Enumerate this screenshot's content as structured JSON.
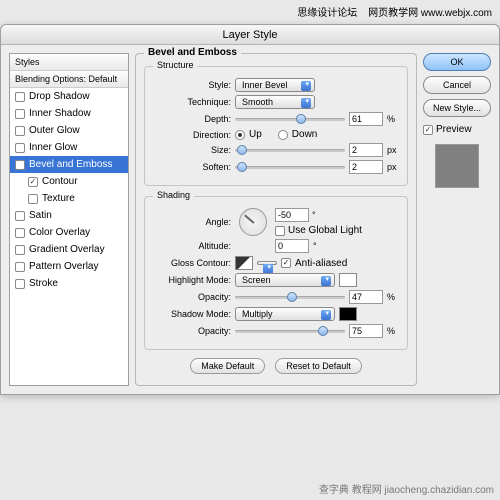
{
  "watermark_left": "思缘设计论坛",
  "watermark_right": "网页教学网 www.webjx.com",
  "window_title": "Layer Style",
  "sidebar": {
    "head": "Styles",
    "blending": "Blending Options: Default",
    "items": [
      {
        "label": "Drop Shadow",
        "checked": false
      },
      {
        "label": "Inner Shadow",
        "checked": false
      },
      {
        "label": "Outer Glow",
        "checked": false
      },
      {
        "label": "Inner Glow",
        "checked": false
      },
      {
        "label": "Bevel and Emboss",
        "checked": true,
        "active": true
      },
      {
        "label": "Contour",
        "checked": true,
        "indent": true
      },
      {
        "label": "Texture",
        "checked": false,
        "indent": true
      },
      {
        "label": "Satin",
        "checked": false
      },
      {
        "label": "Color Overlay",
        "checked": false
      },
      {
        "label": "Gradient Overlay",
        "checked": false
      },
      {
        "label": "Pattern Overlay",
        "checked": false
      },
      {
        "label": "Stroke",
        "checked": false
      }
    ]
  },
  "group_title": "Bevel and Emboss",
  "structure": {
    "legend": "Structure",
    "style_lbl": "Style:",
    "style_val": "Inner Bevel",
    "tech_lbl": "Technique:",
    "tech_val": "Smooth",
    "depth_lbl": "Depth:",
    "depth_val": "61",
    "depth_unit": "%",
    "dir_lbl": "Direction:",
    "up": "Up",
    "down": "Down",
    "size_lbl": "Size:",
    "size_val": "2",
    "size_unit": "px",
    "soften_lbl": "Soften:",
    "soften_val": "2",
    "soften_unit": "px"
  },
  "shading": {
    "legend": "Shading",
    "angle_lbl": "Angle:",
    "angle_val": "-50",
    "angle_unit": "°",
    "global": "Use Global Light",
    "alt_lbl": "Altitude:",
    "alt_val": "0",
    "alt_unit": "°",
    "contour_lbl": "Gloss Contour:",
    "aa": "Anti-aliased",
    "hl_lbl": "Highlight Mode:",
    "hl_val": "Screen",
    "op1_lbl": "Opacity:",
    "op1_val": "47",
    "op1_unit": "%",
    "sh_lbl": "Shadow Mode:",
    "sh_val": "Multiply",
    "op2_lbl": "Opacity:",
    "op2_val": "75",
    "op2_unit": "%"
  },
  "btn_make": "Make Default",
  "btn_reset": "Reset to Default",
  "right": {
    "ok": "OK",
    "cancel": "Cancel",
    "new": "New Style...",
    "preview": "Preview"
  },
  "footer": "查字典 教程网 jiaocheng.chazidian.com"
}
